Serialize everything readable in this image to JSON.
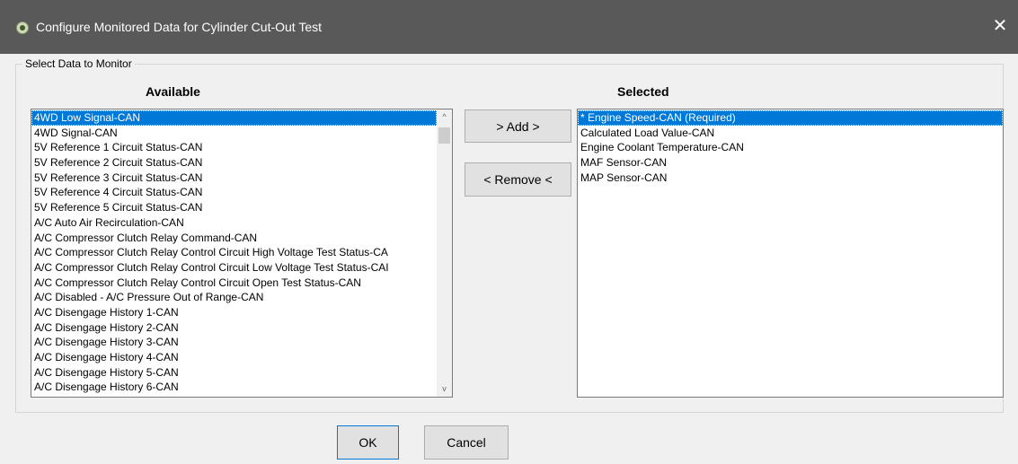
{
  "window": {
    "title": "Configure Monitored Data for Cylinder Cut-Out Test",
    "close_glyph": "✕",
    "app_icon": "app-logo-icon"
  },
  "group": {
    "label": "Select Data to Monitor"
  },
  "available": {
    "heading": "Available",
    "items": [
      "4WD Low Signal-CAN",
      "4WD Signal-CAN",
      "5V Reference 1 Circuit Status-CAN",
      "5V Reference 2 Circuit Status-CAN",
      "5V Reference 3 Circuit Status-CAN",
      "5V Reference 4 Circuit Status-CAN",
      "5V Reference 5 Circuit Status-CAN",
      "A/C Auto Air Recirculation-CAN",
      "A/C Compressor Clutch Relay Command-CAN",
      "A/C Compressor Clutch Relay Control Circuit High Voltage Test Status-CA",
      "A/C Compressor Clutch Relay Control Circuit Low Voltage Test Status-CAI",
      "A/C Compressor Clutch Relay Control Circuit Open Test Status-CAN",
      "A/C Disabled - A/C Pressure Out of Range-CAN",
      "A/C Disengage History 1-CAN",
      "A/C Disengage History 2-CAN",
      "A/C Disengage History 3-CAN",
      "A/C Disengage History 4-CAN",
      "A/C Disengage History 5-CAN",
      "A/C Disengage History 6-CAN"
    ],
    "selected_index": 0,
    "scroll_up_glyph": "^",
    "scroll_down_glyph": "v"
  },
  "selected": {
    "heading": "Selected",
    "items": [
      "* Engine Speed-CAN (Required)",
      "Calculated Load Value-CAN",
      "Engine Coolant Temperature-CAN",
      "MAF Sensor-CAN",
      "MAP Sensor-CAN"
    ],
    "selected_index": 0
  },
  "buttons": {
    "add": "> Add >",
    "remove": "< Remove <",
    "ok": "OK",
    "cancel": "Cancel"
  },
  "colors": {
    "titlebar": "#595959",
    "selection": "#0078d7",
    "background": "#f0f0f0"
  }
}
